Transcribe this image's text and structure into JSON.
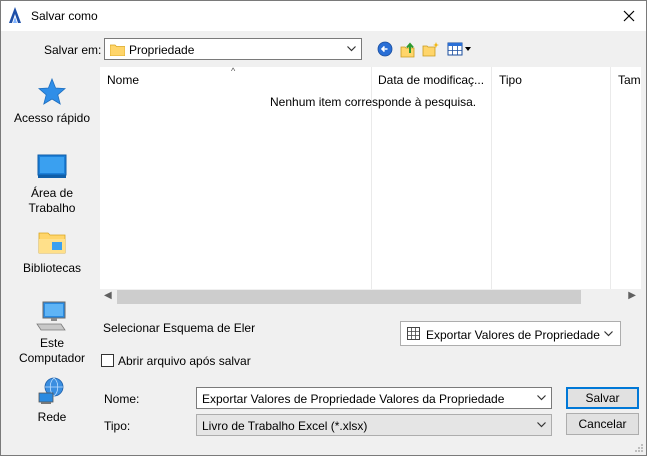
{
  "window": {
    "title": "Salvar como"
  },
  "toolbar": {
    "save_in_label": "Salvar em:",
    "location": "Propriedade"
  },
  "places": [
    {
      "label": "Acesso rápido",
      "icon": "star-icon"
    },
    {
      "label": "Área de Trabalho",
      "icon": "desktop-icon"
    },
    {
      "label": "Bibliotecas",
      "icon": "libraries-icon"
    },
    {
      "label": "Este Computador",
      "icon": "computer-icon"
    },
    {
      "label": "Rede",
      "icon": "network-icon"
    }
  ],
  "filelist": {
    "columns": [
      "Nome",
      "Data de modificaç...",
      "Tipo",
      "Tam"
    ],
    "empty_message": "Nenhum item corresponde à pesquisa."
  },
  "scheme": {
    "label": "Selecionar Esquema de Eler",
    "value": "Exportar Valores de Propriedade"
  },
  "options": {
    "open_after_save_label": "Abrir arquivo após salvar",
    "open_after_save_checked": false
  },
  "form": {
    "name_label": "Nome:",
    "name_value": "Exportar Valores de Propriedade Valores da Propriedade",
    "type_label": "Tipo:",
    "type_value": "Livro de Trabalho Excel (*.xlsx)"
  },
  "buttons": {
    "save": "Salvar",
    "cancel": "Cancelar"
  },
  "colors": {
    "accent": "#0078d7",
    "window_bg": "#f0f0f0"
  }
}
